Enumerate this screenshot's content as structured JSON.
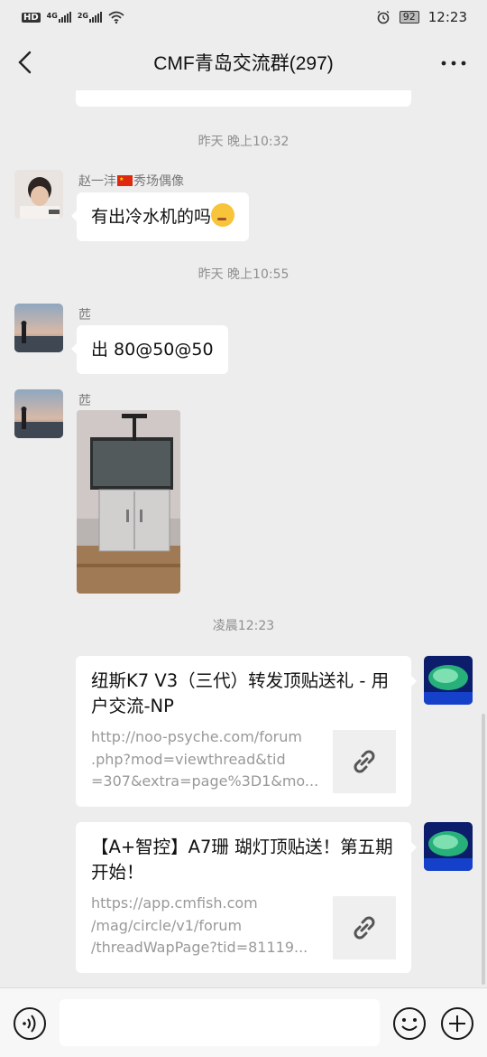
{
  "status_bar": {
    "network_hd": "HD",
    "sim1": "4G",
    "sim2": "2G",
    "battery": "92",
    "time": "12:23"
  },
  "header": {
    "title": "CMF青岛交流群(297)"
  },
  "icons": {
    "back": "chevron-left-icon",
    "more": "more-dots-icon",
    "link": "link-icon",
    "voice": "voice-icon",
    "emoji": "emoji-icon",
    "add": "plus-icon"
  },
  "messages": {
    "time1": "昨天 晚上10:32",
    "msg1": {
      "sender_a": "赵一沣",
      "sender_b": "秀场偶像",
      "text": "有出冷水机的吗"
    },
    "time2": "昨天 晚上10:55",
    "msg2": {
      "sender": "苉",
      "text": "出 80@50@50"
    },
    "msg3": {
      "sender": "苉"
    },
    "time3": "凌晨12:23",
    "card1": {
      "title": "纽斯K7 V3（三代）转发顶贴送礼 - 用户交流-NP",
      "url_line1": "http://noo-psyche.com/forum",
      "url_line2": ".php?mod=viewthread&tid",
      "url_line3": "=307&extra=page%3D1&mo..."
    },
    "card2": {
      "title": "【A+智控】A7珊 瑚灯顶贴送！第五期开始！",
      "url_line1": "https://app.cmfish.com",
      "url_line2": "/mag/circle/v1/forum",
      "url_line3": "/threadWapPage?tid=81119..."
    }
  },
  "colors": {
    "chat_bg": "#ededed",
    "bubble": "#ffffff",
    "muted_text": "#8f8f8f"
  }
}
